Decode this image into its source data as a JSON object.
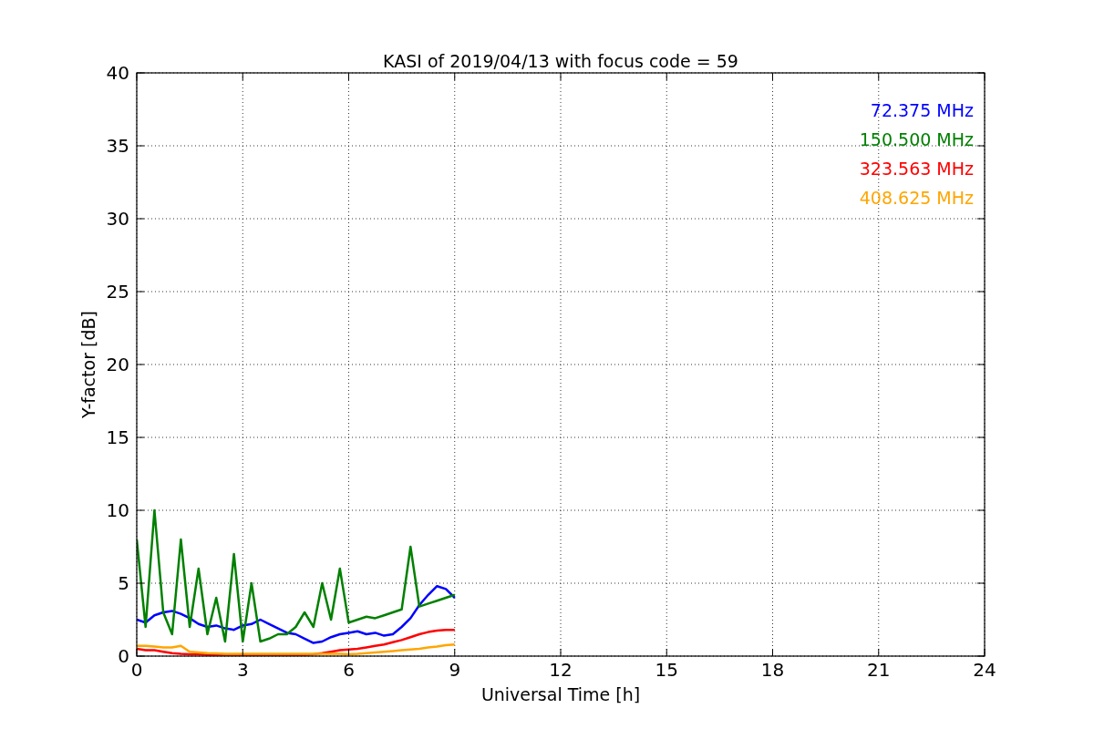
{
  "chart_data": {
    "type": "line",
    "title": "KASI of 2019/04/13 with focus code = 59",
    "xlabel": "Universal Time [h]",
    "ylabel": "Y-factor [dB]",
    "x": [
      0,
      0.25,
      0.5,
      0.75,
      1,
      1.25,
      1.5,
      1.75,
      2,
      2.25,
      2.5,
      2.75,
      3,
      3.25,
      3.5,
      3.75,
      4,
      4.25,
      4.5,
      4.75,
      5,
      5.25,
      5.5,
      5.75,
      6,
      6.25,
      6.5,
      6.75,
      7,
      7.25,
      7.5,
      7.75,
      8,
      8.25,
      8.5,
      8.75,
      9
    ],
    "series": [
      {
        "name": "72.375 MHz",
        "color": "#0000ff",
        "values": [
          2.5,
          2.3,
          2.8,
          3,
          3.1,
          2.9,
          2.6,
          2.2,
          2,
          2.1,
          1.9,
          1.8,
          2.1,
          2.2,
          2.5,
          2.2,
          1.9,
          1.6,
          1.5,
          1.2,
          0.9,
          1,
          1.3,
          1.5,
          1.6,
          1.7,
          1.5,
          1.6,
          1.4,
          1.5,
          2,
          2.6,
          3.5,
          4.2,
          4.8,
          4.6,
          4
        ]
      },
      {
        "name": "150.500 MHz",
        "color": "#008000",
        "values": [
          8,
          2,
          10,
          3,
          1.5,
          8,
          2,
          6,
          1.5,
          4,
          1,
          7,
          1,
          5,
          1,
          1.2,
          1.5,
          1.5,
          2,
          3,
          2,
          5,
          2.5,
          6,
          2.3,
          2.5,
          2.7,
          2.6,
          2.8,
          3,
          3.2,
          7.5,
          3.4,
          3.6,
          3.8,
          4,
          4.2
        ]
      },
      {
        "name": "323.563 MHz",
        "color": "#ff0000",
        "values": [
          0.5,
          0.4,
          0.4,
          0.3,
          0.2,
          0.15,
          0.12,
          0.12,
          0.1,
          0.1,
          0.1,
          0.1,
          0.1,
          0.1,
          0.1,
          0.1,
          0.1,
          0.1,
          0.1,
          0.1,
          0.12,
          0.2,
          0.3,
          0.4,
          0.45,
          0.5,
          0.6,
          0.7,
          0.8,
          0.95,
          1.1,
          1.3,
          1.5,
          1.65,
          1.75,
          1.8,
          1.8
        ]
      },
      {
        "name": "408.625 MHz",
        "color": "#ffa500",
        "values": [
          0.7,
          0.7,
          0.65,
          0.6,
          0.6,
          0.7,
          0.3,
          0.25,
          0.2,
          0.18,
          0.16,
          0.15,
          0.15,
          0.15,
          0.15,
          0.15,
          0.15,
          0.15,
          0.15,
          0.15,
          0.15,
          0.15,
          0.15,
          0.15,
          0.12,
          0.15,
          0.2,
          0.25,
          0.3,
          0.35,
          0.4,
          0.45,
          0.5,
          0.6,
          0.65,
          0.75,
          0.8
        ]
      }
    ],
    "xlim": [
      0,
      24
    ],
    "ylim": [
      0,
      40
    ],
    "xticks": [
      0,
      3,
      6,
      9,
      12,
      15,
      18,
      21,
      24
    ],
    "yticks": [
      0,
      5,
      10,
      15,
      20,
      25,
      30,
      35,
      40
    ],
    "grid": true
  }
}
